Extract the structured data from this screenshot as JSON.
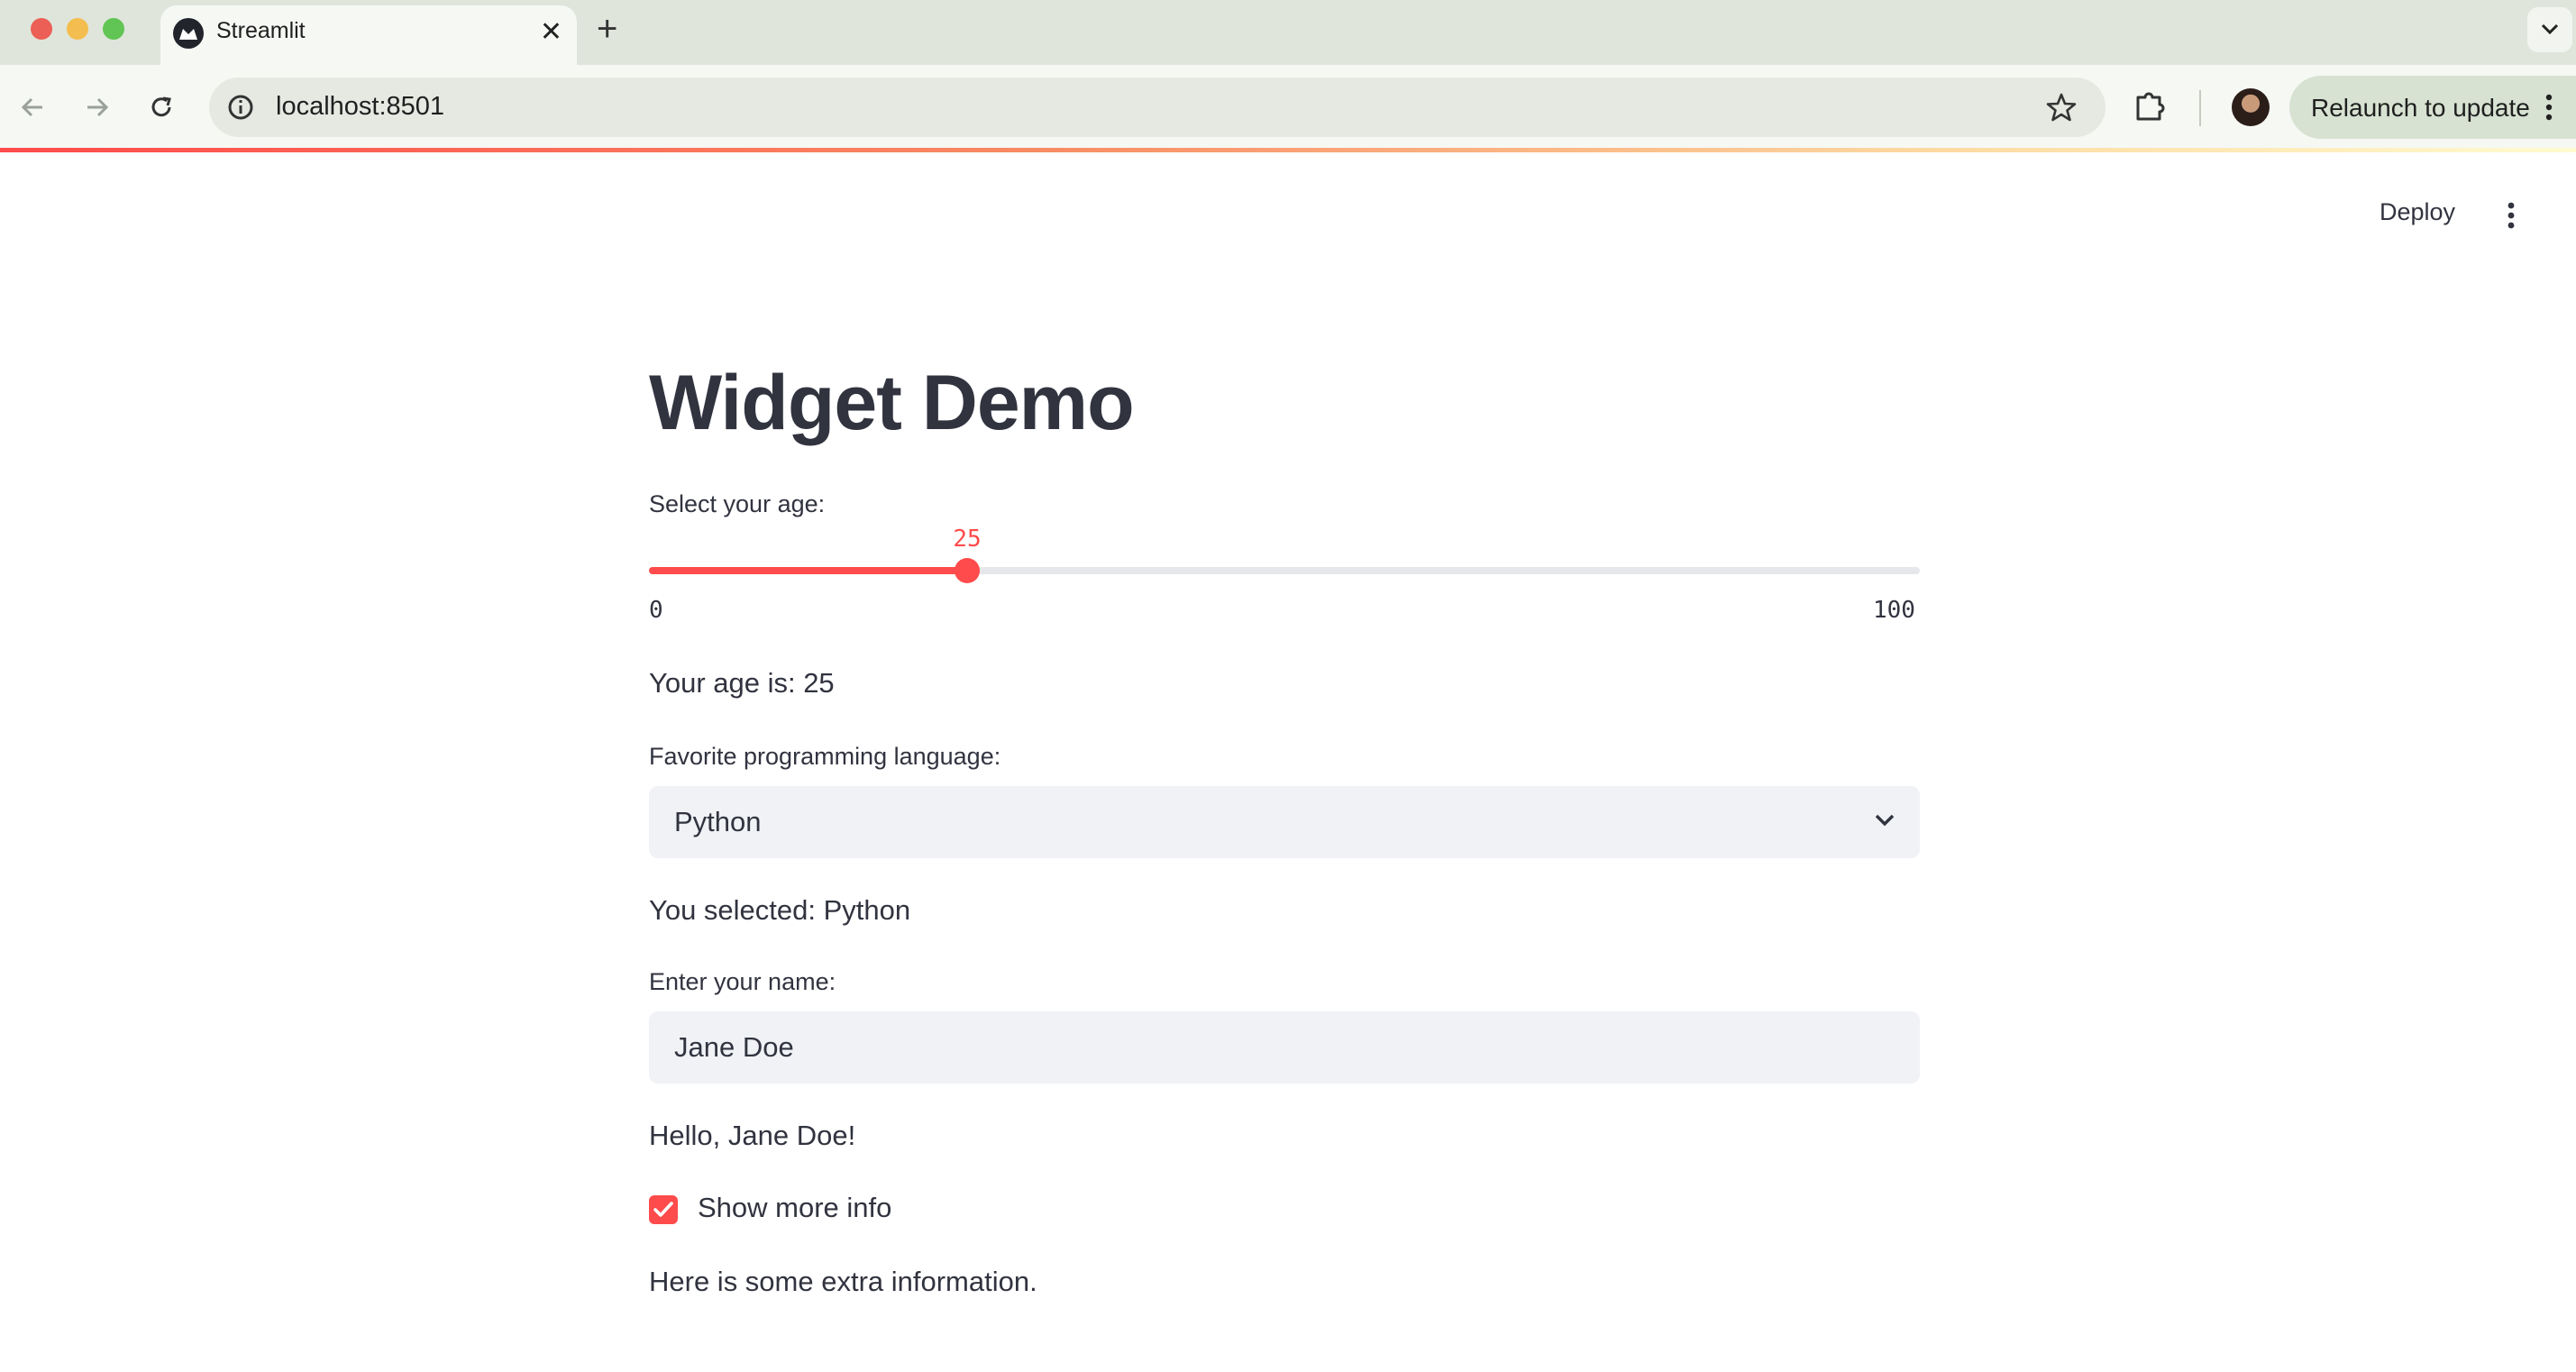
{
  "browser": {
    "tab_title": "Streamlit",
    "url": "localhost:8501",
    "relaunch_label": "Relaunch to update"
  },
  "header": {
    "deploy_label": "Deploy"
  },
  "app": {
    "title": "Widget Demo",
    "slider": {
      "label": "Select your age:",
      "value": "25",
      "min": "0",
      "max": "100",
      "fraction": 0.25
    },
    "age_output": "Your age is: 25",
    "select": {
      "label": "Favorite programming language:",
      "value": "Python"
    },
    "select_output": "You selected: Python",
    "text_input": {
      "label": "Enter your name:",
      "value": "Jane Doe"
    },
    "greeting": "Hello, Jane Doe!",
    "checkbox": {
      "label": "Show more info",
      "checked": true
    },
    "extra_info": "Here is some extra information."
  },
  "colors": {
    "accent": "#ff4b4b",
    "text": "#31333f",
    "input_bg": "#f0f2f6"
  },
  "icons": [
    "back-arrow-icon",
    "forward-arrow-icon",
    "reload-icon",
    "site-info-icon",
    "bookmark-star-icon",
    "extensions-icon",
    "kebab-menu-icon",
    "chevron-down-icon",
    "checkmark-icon",
    "close-icon",
    "plus-icon"
  ]
}
